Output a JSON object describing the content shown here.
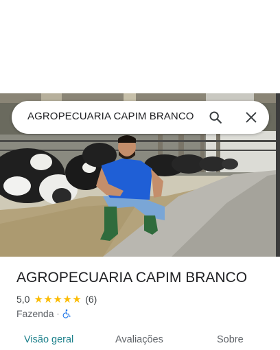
{
  "search": {
    "query": "AGROPECUARIA CAPIM BRANCO"
  },
  "place": {
    "name": "AGROPECUARIA CAPIM BRANCO",
    "rating": "5,0",
    "stars": [
      "★",
      "★",
      "★",
      "★",
      "★"
    ],
    "review_count": "(6)",
    "category": "Fazenda",
    "separator": "·"
  },
  "tabs": [
    {
      "label": "Visão geral"
    },
    {
      "label": "Avaliações"
    },
    {
      "label": "Sobre"
    }
  ],
  "colors": {
    "accent": "#1a7f8a",
    "star": "#fbbc04",
    "accessibility": "#1a73e8"
  },
  "icons": {
    "search": "search-icon",
    "close": "close-icon",
    "accessibility": "wheelchair-icon"
  }
}
